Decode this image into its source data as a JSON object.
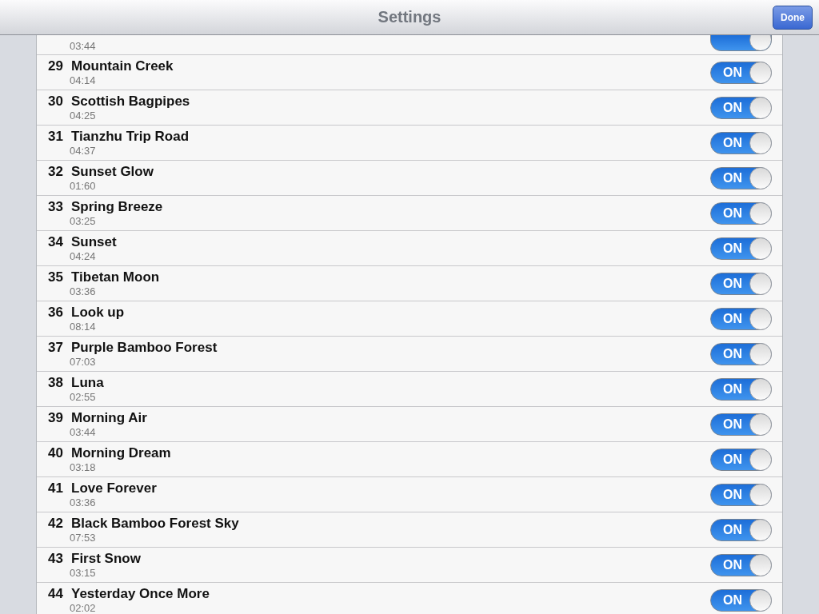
{
  "nav_bar": {
    "title": "Settings",
    "done_button": "Done"
  },
  "tracks": [
    {
      "duration": "03:44",
      "on": true
    },
    {
      "number": "29",
      "title": "Mountain Creek",
      "duration": "04:14",
      "on_label": "ON",
      "on": true
    },
    {
      "number": "30",
      "title": "Scottish Bagpipes",
      "duration": "04:25",
      "on_label": "ON",
      "on": true
    },
    {
      "number": "31",
      "title": "Tianzhu Trip Road",
      "duration": "04:37",
      "on_label": "ON",
      "on": true
    },
    {
      "number": "32",
      "title": "Sunset Glow",
      "duration": "01:60",
      "on_label": "ON",
      "on": true
    },
    {
      "number": "33",
      "title": "Spring Breeze",
      "duration": "03:25",
      "on_label": "ON",
      "on": true
    },
    {
      "number": "34",
      "title": "Sunset",
      "duration": "04:24",
      "on_label": "ON",
      "on": true
    },
    {
      "number": "35",
      "title": "Tibetan Moon",
      "duration": "03:36",
      "on_label": "ON",
      "on": true
    },
    {
      "number": "36",
      "title": "Look up",
      "duration": "08:14",
      "on_label": "ON",
      "on": true
    },
    {
      "number": "37",
      "title": "Purple Bamboo Forest",
      "duration": "07:03",
      "on_label": "ON",
      "on": true
    },
    {
      "number": "38",
      "title": "Luna",
      "duration": "02:55",
      "on_label": "ON",
      "on": true
    },
    {
      "number": "39",
      "title": "Morning Air",
      "duration": "03:44",
      "on_label": "ON",
      "on": true
    },
    {
      "number": "40",
      "title": "Morning Dream",
      "duration": "03:18",
      "on_label": "ON",
      "on": true
    },
    {
      "number": "41",
      "title": "Love Forever",
      "duration": "03:36",
      "on_label": "ON",
      "on": true
    },
    {
      "number": "42",
      "title": "Black Bamboo Forest Sky",
      "duration": "07:53",
      "on_label": "ON",
      "on": true
    },
    {
      "number": "43",
      "title": "First Snow",
      "duration": "03:15",
      "on_label": "ON",
      "on": true
    },
    {
      "number": "44",
      "title": "Yesterday Once More",
      "duration": "02:02",
      "on_label": "ON",
      "on": true
    }
  ]
}
